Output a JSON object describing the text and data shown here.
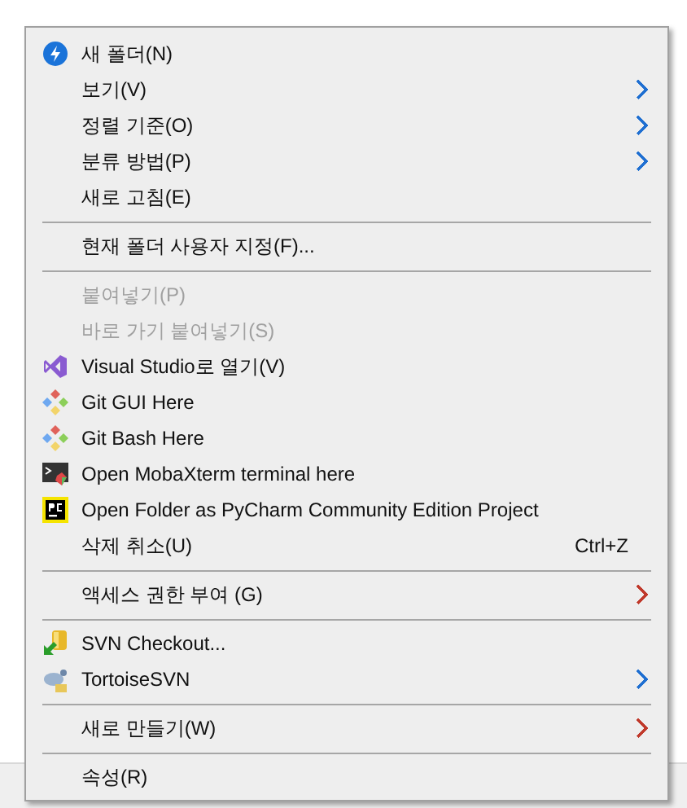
{
  "menu": {
    "items": [
      {
        "kind": "item",
        "label": "새 폴더(N)",
        "disabled": false
      },
      {
        "kind": "item",
        "label": "보기(V)",
        "disabled": false,
        "submenu": true,
        "color": "#1f6fd1"
      },
      {
        "kind": "item",
        "label": "정렬 기준(O)",
        "disabled": false,
        "submenu": true,
        "color": "#1f6fd1"
      },
      {
        "kind": "item",
        "label": "분류 방법(P)",
        "disabled": false,
        "submenu": true,
        "color": "#1f6fd1"
      },
      {
        "kind": "item",
        "label": "새로 고침(E)",
        "disabled": false
      },
      {
        "kind": "separator"
      },
      {
        "kind": "item",
        "label": "현재 폴더 사용자 지정(F)...",
        "disabled": false
      },
      {
        "kind": "separator"
      },
      {
        "kind": "item",
        "label": "붙여넣기(P)",
        "disabled": true
      },
      {
        "kind": "item",
        "label": "바로 가기 붙여넣기(S)",
        "disabled": true
      },
      {
        "kind": "item",
        "label": "Visual Studio로 열기(V)",
        "disabled": false
      },
      {
        "kind": "item",
        "label": "Git GUI Here",
        "disabled": false
      },
      {
        "kind": "item",
        "label": "Git Bash Here",
        "disabled": false
      },
      {
        "kind": "item",
        "label": "Open MobaXterm terminal here",
        "disabled": false
      },
      {
        "kind": "item",
        "label": "Open Folder as PyCharm Community Edition Project",
        "disabled": false
      },
      {
        "kind": "item",
        "label": "삭제 취소(U)",
        "disabled": false,
        "shortcut": "Ctrl+Z"
      },
      {
        "kind": "separator"
      },
      {
        "kind": "item",
        "label": "액세스 권한 부여 (G)",
        "disabled": false,
        "submenu": true,
        "color": "#c0392b"
      },
      {
        "kind": "separator"
      },
      {
        "kind": "item",
        "label": "SVN Checkout...",
        "disabled": false
      },
      {
        "kind": "item",
        "label": "TortoiseSVN",
        "disabled": false,
        "submenu": true,
        "color": "#1f6fd1"
      },
      {
        "kind": "separator"
      },
      {
        "kind": "item",
        "label": "새로 만들기(W)",
        "disabled": false,
        "submenu": true,
        "color": "#c0392b"
      },
      {
        "kind": "separator"
      },
      {
        "kind": "item",
        "label": "속성(R)",
        "disabled": false
      }
    ]
  }
}
